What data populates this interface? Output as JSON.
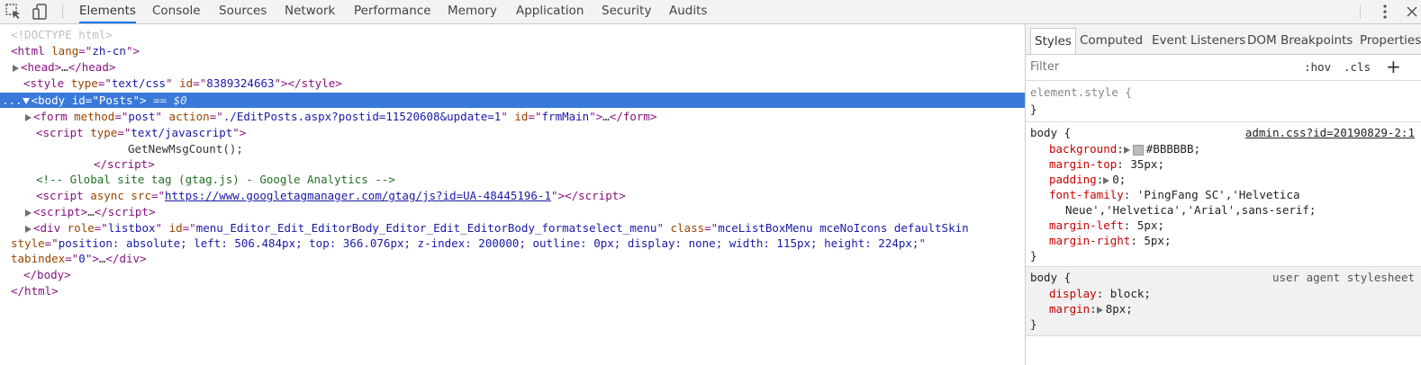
{
  "toolbar": {
    "icons": [
      "inspect-cursor-icon",
      "device-toggle-icon"
    ],
    "tabs": [
      "Elements",
      "Console",
      "Sources",
      "Network",
      "Performance",
      "Memory",
      "Application",
      "Security",
      "Audits"
    ],
    "active_tab": "Elements"
  },
  "dom": {
    "doctype": "<!DOCTYPE html>",
    "html_open": {
      "tag": "html",
      "attr": "lang",
      "val": "zh-cn"
    },
    "head": {
      "open": "<head>",
      "ellipsis": "…",
      "close": "</head>"
    },
    "style": {
      "attr1": "type",
      "val1": "text/css",
      "attr2": "id",
      "val2": "8389324663"
    },
    "body": {
      "attr": "id",
      "val": "Posts",
      "eq": "== $0",
      "dots": "..."
    },
    "form": {
      "attr1": "method",
      "val1": "post",
      "attr2": "action",
      "val2": "./EditPosts.aspx?postid=11520608&update=1",
      "attr3": "id",
      "val3": "frmMain"
    },
    "script1": {
      "attr": "type",
      "val": "text/javascript",
      "code": "GetNewMsgCount();"
    },
    "comment": "<!-- Global site tag (gtag.js) - Google Analytics -->",
    "script_async": {
      "attr": "src",
      "url": "https://www.googletagmanager.com/gtag/js?id=UA-48445196-1"
    },
    "div": {
      "role": "listbox",
      "id": "menu_Editor_Edit_EditorBody_Editor_Edit_EditorBody_formatselect_menu",
      "class": "mceListBoxMenu mceNoIcons defaultSkin",
      "style": "position: absolute; left: 506.484px; top: 366.076px; z-index: 200000; outline: 0px; display: none; width: 115px; height: 224px;",
      "tabindex": "0"
    }
  },
  "styles_pane": {
    "tabs": [
      "Styles",
      "Computed",
      "Event Listeners",
      "DOM Breakpoints",
      "Properties"
    ],
    "filter_placeholder": "Filter",
    "hov": ":hov",
    "cls": ".cls",
    "plus": "+",
    "element_style": "element.style {",
    "close_brace": "}",
    "rule1": {
      "selector": "body {",
      "source": "admin.css?id=20190829-2:1",
      "declarations": [
        {
          "prop": "background",
          "val": "#BBBBBB",
          "swatch": "#BBBBBB",
          "expandable": true
        },
        {
          "prop": "margin-top",
          "val": "35px"
        },
        {
          "prop": "padding",
          "val": "0",
          "expandable": true
        },
        {
          "prop": "font-family",
          "val": "'PingFang SC','Helvetica",
          "cont": "Neue','Helvetica','Arial',sans-serif;"
        },
        {
          "prop": "margin-left",
          "val": "5px"
        },
        {
          "prop": "margin-right",
          "val": "5px"
        }
      ]
    },
    "rule2": {
      "selector": "body {",
      "source": "user agent stylesheet",
      "declarations": [
        {
          "prop": "display",
          "val": "block"
        },
        {
          "prop": "margin",
          "val": "8px",
          "expandable": true
        }
      ]
    }
  }
}
